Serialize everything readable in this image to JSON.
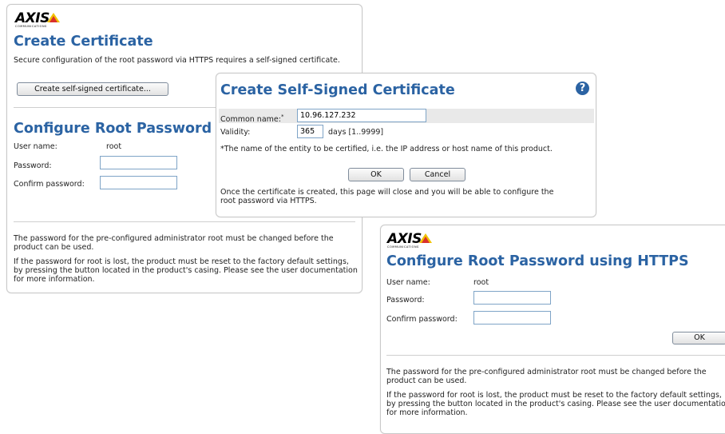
{
  "logo": {
    "text": "AXIS",
    "subtext": "COMMUNICATIONS"
  },
  "create_cert": {
    "title": "Create Certificate",
    "description": "Secure configuration of the root password via HTTPS requires a self-signed certificate.",
    "button_label": "Create self-signed certificate..."
  },
  "configure_root": {
    "title": "Configure Root Password",
    "username_label": "User name:",
    "username_value": "root",
    "password_label": "Password:",
    "confirm_label": "Confirm password:",
    "note1": "The password for the pre-configured administrator root must be changed before the product can be used.",
    "note2": "If the password for root is lost, the product must be reset to the factory default settings, by pressing the button located in the product's casing. Please see the user documentation for more information."
  },
  "self_signed_dialog": {
    "title": "Create Self-Signed Certificate",
    "help_icon": "?",
    "common_name_label": "Common name:",
    "common_name_marker": "*",
    "common_name_value": "10.96.127.232",
    "validity_label": "Validity:",
    "validity_value": "365",
    "validity_hint": "days [1..9999]",
    "footnote": "*The name of the entity to be certified, i.e. the IP address or host name of this product.",
    "ok_label": "OK",
    "cancel_label": "Cancel",
    "info": "Once the certificate is created, this page will close and you will be able to configure the root password via HTTPS."
  },
  "https_panel": {
    "title": "Configure Root Password using HTTPS",
    "username_label": "User name:",
    "username_value": "root",
    "password_label": "Password:",
    "confirm_label": "Confirm password:",
    "ok_label": "OK",
    "note1": "The password for the pre-configured administrator root must be changed before the product can be used.",
    "note2": "If the password for root is lost, the product must be reset to the factory default settings, by pressing the button located in the product's casing. Please see the user documentation for more information."
  },
  "colors": {
    "accent": "#2b63a3",
    "logo_triangle": "#f2c200",
    "logo_triangle_dark": "#d9302c"
  }
}
